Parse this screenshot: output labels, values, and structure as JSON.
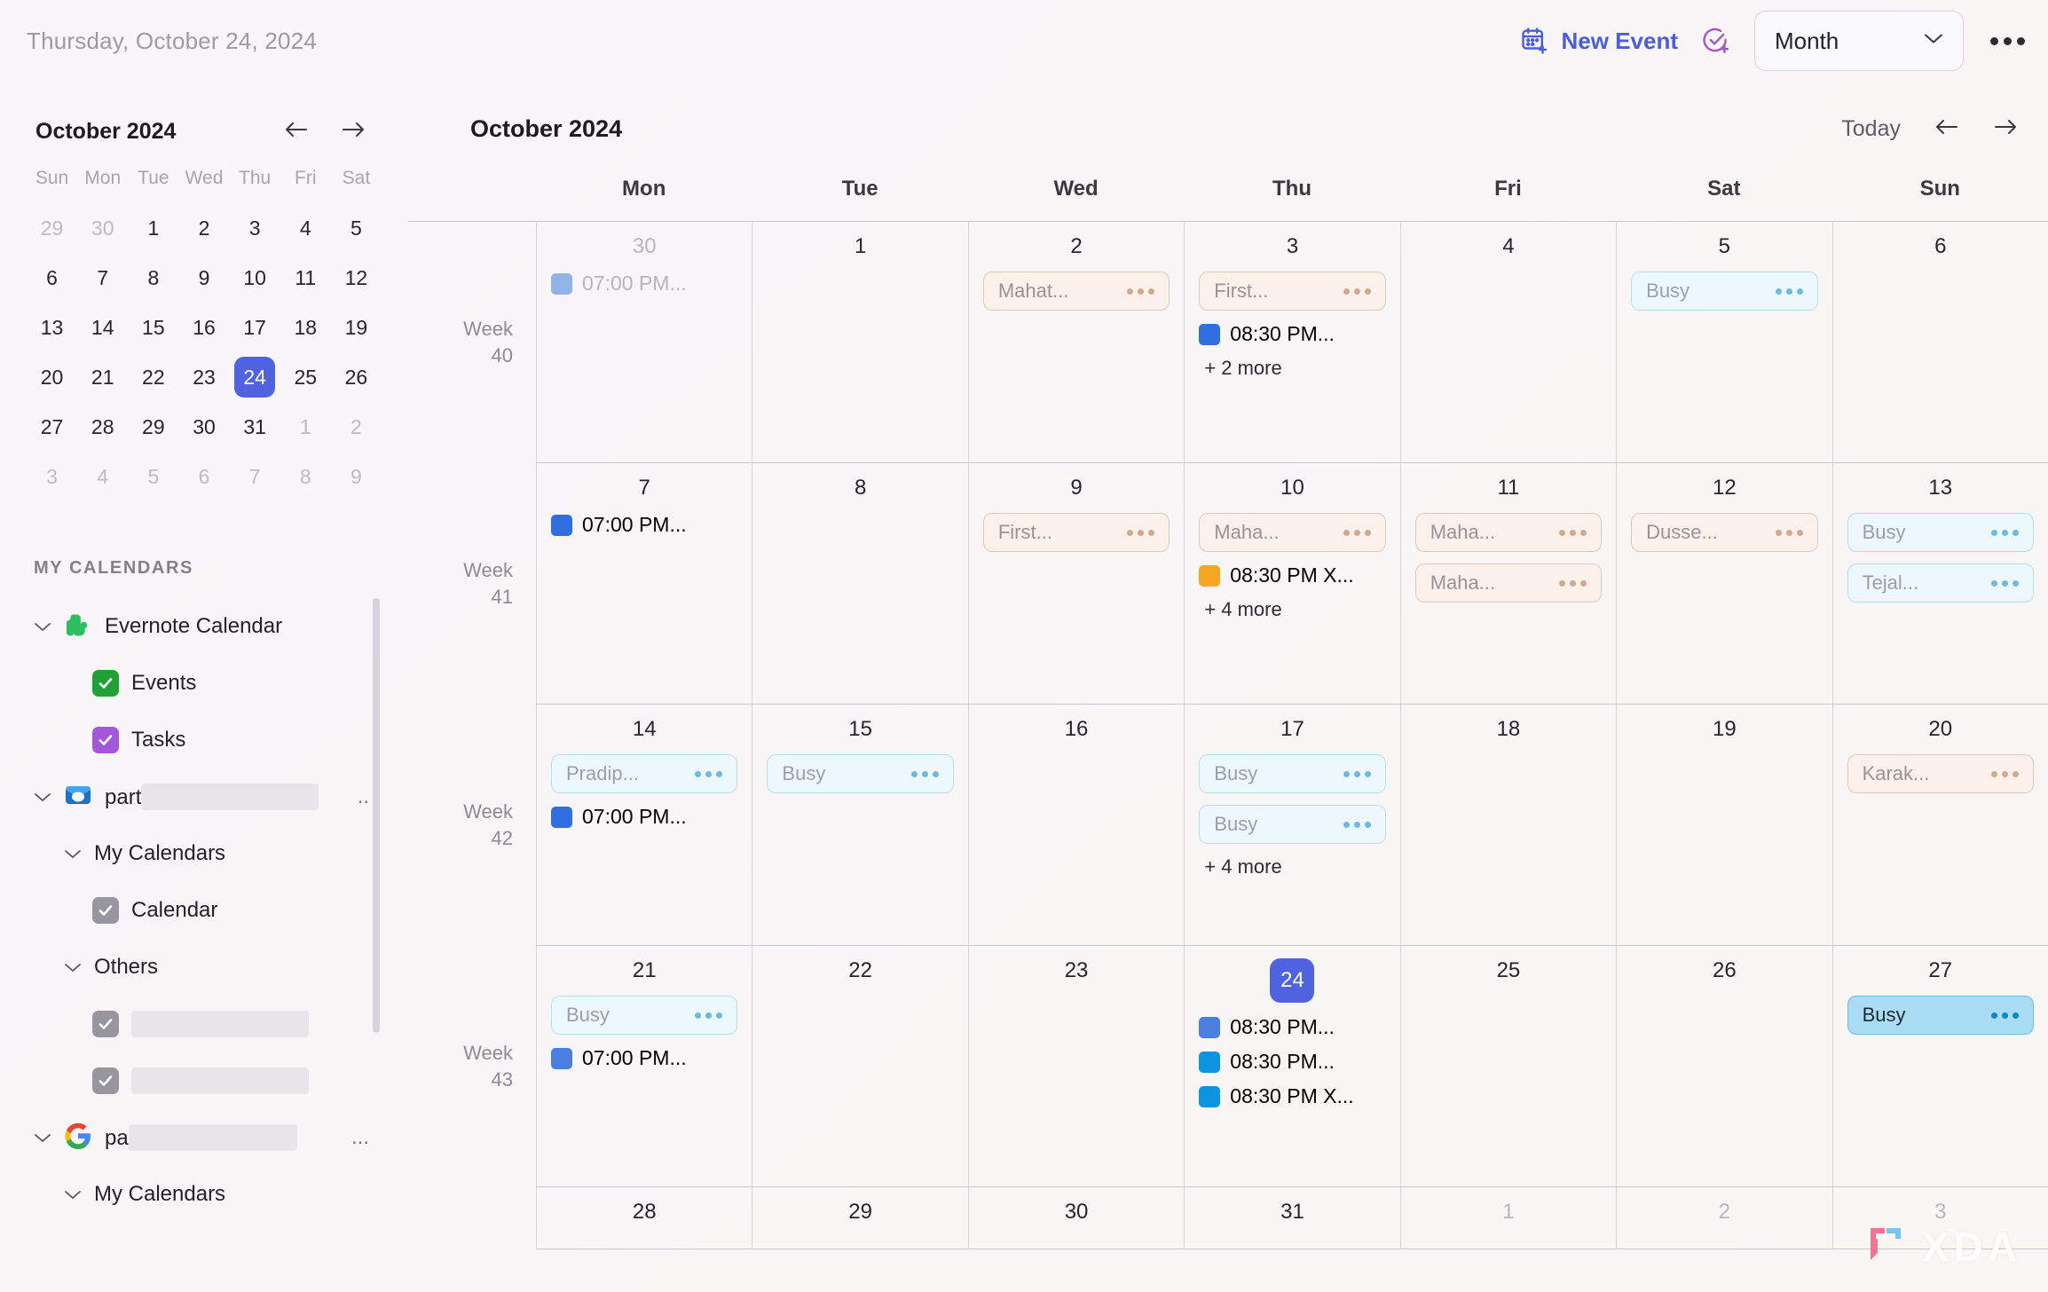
{
  "topbar": {
    "current_date": "Thursday, October 24, 2024",
    "new_event_label": "New Event",
    "new_event_icon": "calendar-plus-icon",
    "new_task_icon": "task-check-plus-icon",
    "view_selected": "Month",
    "view_chevron_icon": "chevron-down-icon",
    "overflow_icon": "more-horizontal-icon",
    "accent_blue": "#4a5ddc",
    "accent_purple": "#a855c8"
  },
  "sidebar": {
    "mini_calendar": {
      "title": "October 2024",
      "prev_icon": "arrow-left-icon",
      "next_icon": "arrow-right-icon",
      "dow": [
        "Sun",
        "Mon",
        "Tue",
        "Wed",
        "Thu",
        "Fri",
        "Sat"
      ],
      "today": 24,
      "today_color": "#4f63e0",
      "weeks": [
        [
          {
            "n": 29,
            "m": true
          },
          {
            "n": 30,
            "m": true
          },
          {
            "n": 1,
            "m": false
          },
          {
            "n": 2,
            "m": false
          },
          {
            "n": 3,
            "m": false
          },
          {
            "n": 4,
            "m": false
          },
          {
            "n": 5,
            "m": false
          }
        ],
        [
          {
            "n": 6,
            "m": false
          },
          {
            "n": 7,
            "m": false
          },
          {
            "n": 8,
            "m": false
          },
          {
            "n": 9,
            "m": false
          },
          {
            "n": 10,
            "m": false
          },
          {
            "n": 11,
            "m": false
          },
          {
            "n": 12,
            "m": false
          }
        ],
        [
          {
            "n": 13,
            "m": false
          },
          {
            "n": 14,
            "m": false
          },
          {
            "n": 15,
            "m": false
          },
          {
            "n": 16,
            "m": false
          },
          {
            "n": 17,
            "m": false
          },
          {
            "n": 18,
            "m": false
          },
          {
            "n": 19,
            "m": false
          }
        ],
        [
          {
            "n": 20,
            "m": false
          },
          {
            "n": 21,
            "m": false
          },
          {
            "n": 22,
            "m": false
          },
          {
            "n": 23,
            "m": false
          },
          {
            "n": 24,
            "m": false
          },
          {
            "n": 25,
            "m": false
          },
          {
            "n": 26,
            "m": false
          }
        ],
        [
          {
            "n": 27,
            "m": false
          },
          {
            "n": 28,
            "m": false
          },
          {
            "n": 29,
            "m": false
          },
          {
            "n": 30,
            "m": false
          },
          {
            "n": 31,
            "m": false
          },
          {
            "n": 1,
            "m": true
          },
          {
            "n": 2,
            "m": true
          }
        ],
        [
          {
            "n": 3,
            "m": true
          },
          {
            "n": 4,
            "m": true
          },
          {
            "n": 5,
            "m": true
          },
          {
            "n": 6,
            "m": true
          },
          {
            "n": 7,
            "m": true
          },
          {
            "n": 8,
            "m": true
          },
          {
            "n": 9,
            "m": true
          }
        ]
      ]
    },
    "section_label": "MY CALENDARS",
    "accounts": [
      {
        "name": "Evernote Calendar",
        "icon": "evernote-elephant-icon",
        "expanded": true,
        "children": [
          {
            "label": "Events",
            "checked": true,
            "color": "#21a038",
            "type": "checkbox"
          },
          {
            "label": "Tasks",
            "checked": true,
            "color": "#a357db",
            "type": "checkbox"
          }
        ]
      },
      {
        "name": "part",
        "name_redacted": true,
        "icon": "outlook-icon",
        "expanded": true,
        "overflow": "..",
        "groups": [
          {
            "label": "My Calendars",
            "expanded": true,
            "children": [
              {
                "label": "Calendar",
                "checked": true,
                "color": "#97959d",
                "type": "checkbox"
              }
            ]
          },
          {
            "label": "Others",
            "expanded": true,
            "children": [
              {
                "label": "",
                "redacted": true,
                "checked": true,
                "color": "#97959d",
                "type": "checkbox"
              },
              {
                "label": "",
                "redacted": true,
                "checked": true,
                "color": "#97959d",
                "type": "checkbox"
              }
            ]
          }
        ]
      },
      {
        "name": "pa",
        "name_redacted": true,
        "icon": "google-icon",
        "expanded": true,
        "overflow": "...",
        "groups": [
          {
            "label": "My Calendars",
            "expanded": true,
            "children": []
          }
        ]
      }
    ]
  },
  "main": {
    "title": "October 2024",
    "today_label": "Today",
    "prev_icon": "arrow-left-icon",
    "next_icon": "arrow-right-icon",
    "dow": [
      "Mon",
      "Tue",
      "Wed",
      "Thu",
      "Fri",
      "Sat",
      "Sun"
    ],
    "weeks": [
      {
        "week_label_line1": "Week",
        "week_label_line2": "40",
        "days": [
          {
            "num": "30",
            "muted": true,
            "events": [
              {
                "kind": "timed",
                "text": "07:00 PM...",
                "color": "#93b4e8",
                "dim": true
              }
            ]
          },
          {
            "num": "1",
            "muted": false,
            "events": []
          },
          {
            "num": "2",
            "muted": false,
            "events": [
              {
                "kind": "chip",
                "style": "peach",
                "text": "Mahat..."
              }
            ]
          },
          {
            "num": "3",
            "muted": false,
            "events": [
              {
                "kind": "chip",
                "style": "peach",
                "text": "First..."
              },
              {
                "kind": "timed",
                "text": "08:30 PM...",
                "color": "#2f6fe0",
                "dim": false
              },
              {
                "kind": "more",
                "text": "+ 2 more"
              }
            ]
          },
          {
            "num": "4",
            "muted": false,
            "events": []
          },
          {
            "num": "5",
            "muted": false,
            "events": [
              {
                "kind": "chip",
                "style": "bluelite",
                "text": "Busy"
              }
            ]
          },
          {
            "num": "6",
            "muted": false,
            "events": []
          }
        ]
      },
      {
        "week_label_line1": "Week",
        "week_label_line2": "41",
        "days": [
          {
            "num": "7",
            "muted": false,
            "events": [
              {
                "kind": "timed",
                "text": "07:00 PM...",
                "color": "#2f6fe0",
                "dim": false
              }
            ]
          },
          {
            "num": "8",
            "muted": false,
            "events": []
          },
          {
            "num": "9",
            "muted": false,
            "events": [
              {
                "kind": "chip",
                "style": "peach",
                "text": "First..."
              }
            ]
          },
          {
            "num": "10",
            "muted": false,
            "events": [
              {
                "kind": "chip",
                "style": "peach",
                "text": "Maha..."
              },
              {
                "kind": "timed",
                "text": "08:30 PM X...",
                "color": "#f5a623",
                "dim": false
              },
              {
                "kind": "more",
                "text": "+ 4 more"
              }
            ]
          },
          {
            "num": "11",
            "muted": false,
            "events": [
              {
                "kind": "chip",
                "style": "peach",
                "text": "Maha..."
              },
              {
                "kind": "chip",
                "style": "peach",
                "text": "Maha..."
              }
            ]
          },
          {
            "num": "12",
            "muted": false,
            "events": [
              {
                "kind": "chip",
                "style": "peach",
                "text": "Dusse..."
              }
            ]
          },
          {
            "num": "13",
            "muted": false,
            "events": [
              {
                "kind": "chip",
                "style": "bluelite",
                "text": "Busy"
              },
              {
                "kind": "chip",
                "style": "bluelite",
                "text": "Tejal..."
              }
            ]
          }
        ]
      },
      {
        "week_label_line1": "Week",
        "week_label_line2": "42",
        "days": [
          {
            "num": "14",
            "muted": false,
            "events": [
              {
                "kind": "chip",
                "style": "bluelite",
                "text": "Pradip..."
              },
              {
                "kind": "timed",
                "text": "07:00 PM...",
                "color": "#2f6fe0",
                "dim": false
              }
            ]
          },
          {
            "num": "15",
            "muted": false,
            "events": [
              {
                "kind": "chip",
                "style": "bluelite",
                "text": "Busy"
              }
            ]
          },
          {
            "num": "16",
            "muted": false,
            "events": []
          },
          {
            "num": "17",
            "muted": false,
            "events": [
              {
                "kind": "chip",
                "style": "bluelite",
                "text": "Busy"
              },
              {
                "kind": "chip",
                "style": "bluelite",
                "text": "Busy"
              },
              {
                "kind": "more",
                "text": "+ 4 more"
              }
            ]
          },
          {
            "num": "18",
            "muted": false,
            "events": []
          },
          {
            "num": "19",
            "muted": false,
            "events": []
          },
          {
            "num": "20",
            "muted": false,
            "events": [
              {
                "kind": "chip",
                "style": "peach",
                "text": "Karak..."
              }
            ]
          }
        ]
      },
      {
        "week_label_line1": "Week",
        "week_label_line2": "43",
        "days": [
          {
            "num": "21",
            "muted": false,
            "events": [
              {
                "kind": "chip",
                "style": "bluelite",
                "text": "Busy"
              },
              {
                "kind": "timed",
                "text": "07:00 PM...",
                "color": "#4a7fe0",
                "dim": false
              }
            ]
          },
          {
            "num": "22",
            "muted": false,
            "events": []
          },
          {
            "num": "23",
            "muted": false,
            "events": []
          },
          {
            "num": "24",
            "muted": false,
            "today": true,
            "events": [
              {
                "kind": "timed",
                "text": "08:30 PM...",
                "color": "#4a7fe0",
                "dim": false
              },
              {
                "kind": "timed",
                "text": "08:30 PM...",
                "color": "#0d93e0",
                "dim": false
              },
              {
                "kind": "timed",
                "text": "08:30 PM X...",
                "color": "#0d93e0",
                "dim": false
              }
            ]
          },
          {
            "num": "25",
            "muted": false,
            "events": []
          },
          {
            "num": "26",
            "muted": false,
            "events": []
          },
          {
            "num": "27",
            "muted": false,
            "events": [
              {
                "kind": "chip",
                "style": "bluesolid",
                "text": "Busy"
              }
            ]
          }
        ]
      },
      {
        "week_label_line1": "",
        "week_label_line2": "",
        "days": [
          {
            "num": "28",
            "muted": false,
            "events": []
          },
          {
            "num": "29",
            "muted": false,
            "events": []
          },
          {
            "num": "30",
            "muted": false,
            "events": []
          },
          {
            "num": "31",
            "muted": false,
            "events": []
          },
          {
            "num": "1",
            "muted": true,
            "events": []
          },
          {
            "num": "2",
            "muted": true,
            "events": []
          },
          {
            "num": "3",
            "muted": true,
            "events": []
          }
        ]
      }
    ]
  },
  "watermark": {
    "text": "XDA"
  }
}
